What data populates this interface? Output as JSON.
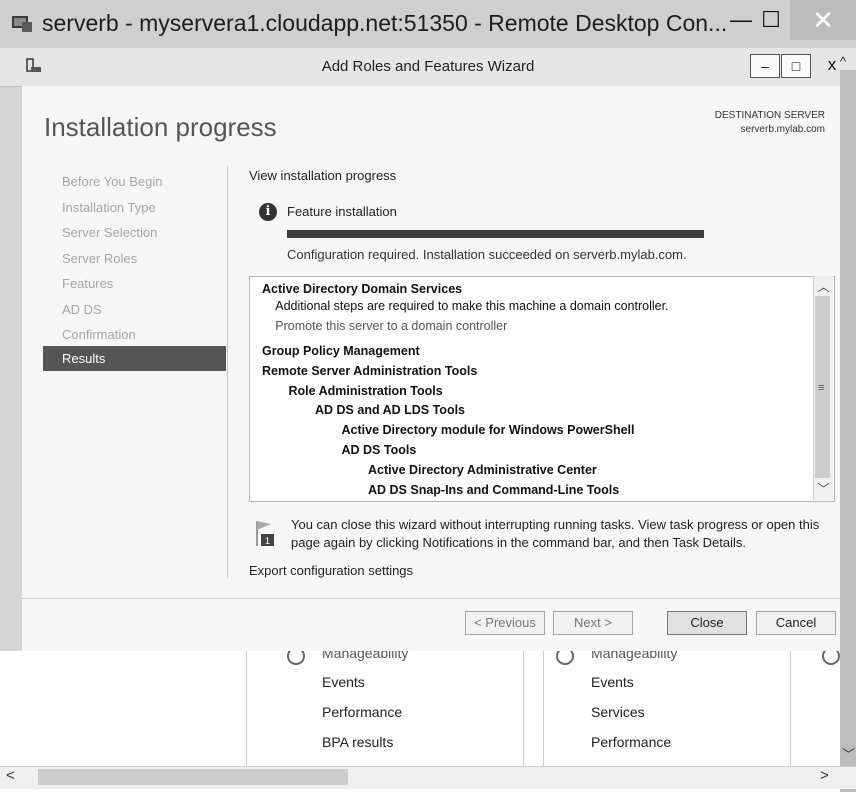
{
  "remote_desktop": {
    "title": "serverb - myservera1.cloudapp.net:51350 - Remote Desktop Con...",
    "minimize": "—",
    "maximize": "☐",
    "close": "✕"
  },
  "wizard": {
    "title": "Add Roles and Features Wizard",
    "minimize": "‒",
    "maximize": "□",
    "close": "x",
    "up": "^"
  },
  "header": {
    "page_title": "Installation progress",
    "destination_caption": "DESTINATION SERVER",
    "destination_server": "serverb.mylab.com"
  },
  "nav": {
    "items": [
      "Before You Begin",
      "Installation Type",
      "Server Selection",
      "Server Roles",
      "Features",
      "AD DS",
      "Confirmation",
      "Results"
    ],
    "selected": "Results"
  },
  "progress": {
    "heading": "View installation progress",
    "feature_label": "Feature installation",
    "fraction": 1.0,
    "status": "Configuration required. Installation succeeded on serverb.mylab.com."
  },
  "results": [
    {
      "text": "Active Directory Domain Services",
      "bold": true,
      "level": 0
    },
    {
      "text": "Additional steps are required to make this machine a domain controller.",
      "bold": false,
      "level": 0.5
    },
    {
      "text": "Promote this server to a domain controller",
      "bold": false,
      "level": 0.5,
      "link": true
    },
    {
      "text": "Group Policy Management",
      "bold": true,
      "level": 0
    },
    {
      "text": "Remote Server Administration Tools",
      "bold": true,
      "level": 0
    },
    {
      "text": "Role Administration Tools",
      "bold": true,
      "level": 1
    },
    {
      "text": "AD DS and AD LDS Tools",
      "bold": true,
      "level": 2
    },
    {
      "text": "Active Directory module for Windows PowerShell",
      "bold": true,
      "level": 3
    },
    {
      "text": "AD DS Tools",
      "bold": true,
      "level": 3
    },
    {
      "text": "Active Directory Administrative Center",
      "bold": true,
      "level": 4
    },
    {
      "text": "AD DS Snap-Ins and Command-Line Tools",
      "bold": true,
      "level": 4
    }
  ],
  "note": "You can close this wizard without interrupting running tasks. View task progress or open this page again by clicking Notifications in the command bar, and then Task Details.",
  "export_link": "Export configuration settings",
  "buttons": {
    "previous": "< Previous",
    "next": "Next >",
    "close": "Close",
    "cancel": "Cancel"
  },
  "background_panels": [
    {
      "header": "Manageability",
      "items": [
        "Events",
        "Performance",
        "BPA results"
      ]
    },
    {
      "header": "Manageability",
      "items": [
        "Events",
        "Services",
        "Performance"
      ]
    }
  ]
}
